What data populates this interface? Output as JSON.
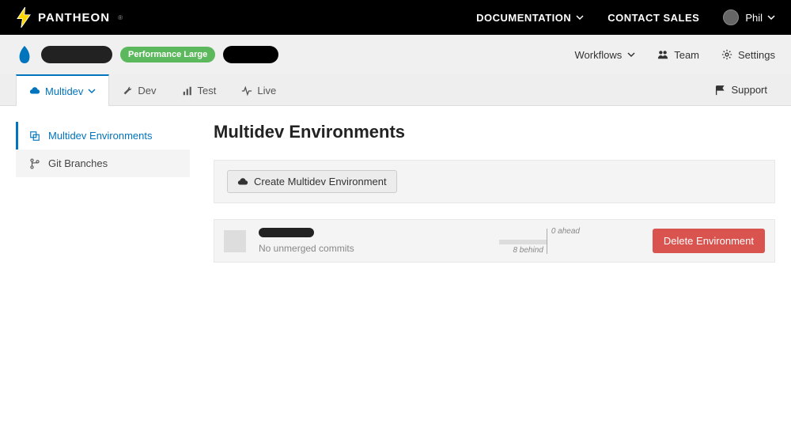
{
  "header": {
    "brand": "PANTHEON",
    "nav": {
      "documentation": "DOCUMENTATION",
      "contact_sales": "CONTACT SALES"
    },
    "user": {
      "name": "Phil"
    }
  },
  "site_bar": {
    "perf_badge": "Performance Large",
    "menu": {
      "workflows": "Workflows",
      "team": "Team",
      "settings": "Settings"
    }
  },
  "tabs": {
    "multidev": "Multidev",
    "dev": "Dev",
    "test": "Test",
    "live": "Live",
    "support": "Support"
  },
  "sidebar": {
    "items": [
      {
        "label": "Multidev Environments"
      },
      {
        "label": "Git Branches"
      }
    ]
  },
  "page": {
    "title": "Multidev Environments",
    "create_label": "Create Multidev Environment"
  },
  "env": {
    "sub_label": "No unmerged commits",
    "ahead_label": "0 ahead",
    "behind_label": "8 behind",
    "delete_label": "Delete Environment"
  }
}
